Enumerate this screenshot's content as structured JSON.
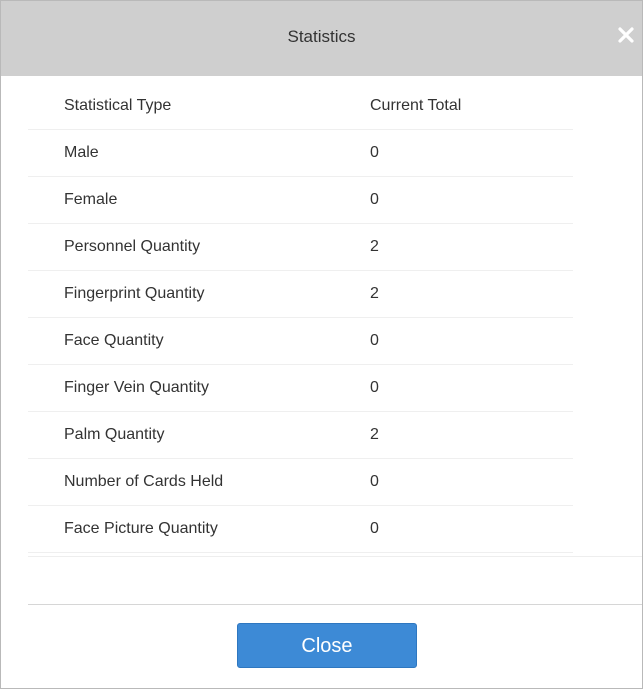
{
  "dialog": {
    "title": "Statistics",
    "close_label": "Close"
  },
  "table": {
    "headers": {
      "type": "Statistical Type",
      "total": "Current Total"
    },
    "rows": [
      {
        "type": "Male",
        "total": "0"
      },
      {
        "type": "Female",
        "total": "0"
      },
      {
        "type": "Personnel Quantity",
        "total": "2"
      },
      {
        "type": "Fingerprint Quantity",
        "total": "2"
      },
      {
        "type": "Face Quantity",
        "total": "0"
      },
      {
        "type": "Finger Vein Quantity",
        "total": "0"
      },
      {
        "type": "Palm Quantity",
        "total": "2"
      },
      {
        "type": "Number of Cards Held",
        "total": "0"
      },
      {
        "type": "Face Picture Quantity",
        "total": "0"
      }
    ]
  },
  "colors": {
    "titlebar": "#cfcfcf",
    "button": "#3d8ad6",
    "text": "#333333"
  },
  "icons": {
    "close": "close-icon"
  }
}
